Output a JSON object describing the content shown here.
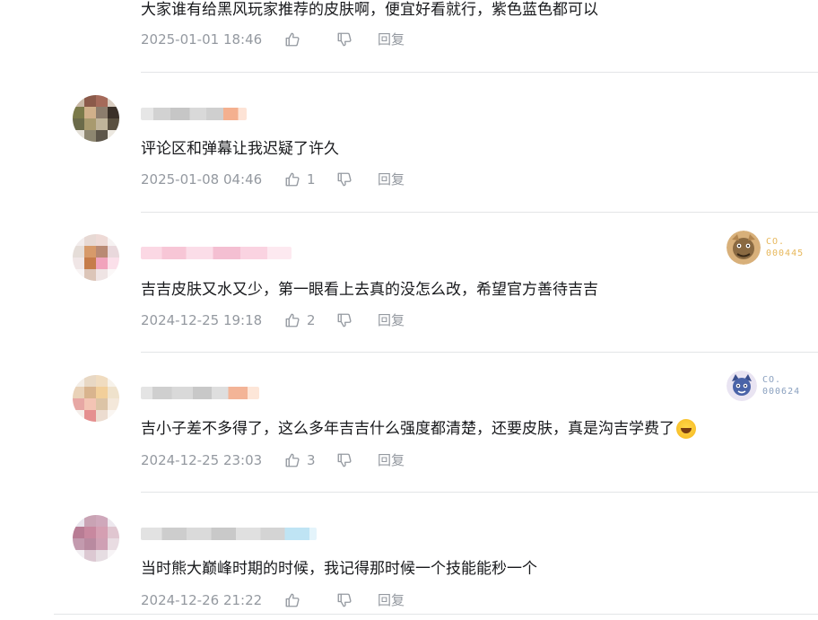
{
  "comments": [
    {
      "text": "大家谁有给黑风玩家推荐的皮肤啊，便宜好看就行，紫色蓝色都可以",
      "time": "2025-01-01 18:46",
      "likes": "",
      "reply": "回复"
    },
    {
      "text": "评论区和弹幕让我迟疑了许久",
      "time": "2025-01-08 04:46",
      "likes": "1",
      "reply": "回复"
    },
    {
      "text": "吉吉皮肤又水又少，第一眼看上去真的没怎么改，希望官方善待吉吉",
      "time": "2024-12-25 19:18",
      "likes": "2",
      "reply": "回复",
      "badge": {
        "line1": "CO.",
        "line2": "000445",
        "color": "#e7b75a"
      }
    },
    {
      "text": "吉小子差不多得了，这么多年吉吉什么强度都清楚，还要皮肤，真是沟吉学费了",
      "time": "2024-12-25 23:03",
      "likes": "3",
      "reply": "回复",
      "emoji": "laughing-crying-emoji",
      "badge": {
        "line1": "CO.",
        "line2": "000624",
        "color": "#8aa0bf"
      }
    },
    {
      "text": "当时熊大巅峰时期的时候，我记得那时候一个技能能秒一个",
      "time": "2024-12-26 21:22",
      "likes": "",
      "reply": "回复"
    }
  ],
  "icons": {
    "like": "thumbs-up-icon",
    "dislike": "thumbs-down-icon"
  },
  "colors": {
    "meta": "#9499a0",
    "text": "#18191c",
    "divider": "#e3e5e7"
  }
}
